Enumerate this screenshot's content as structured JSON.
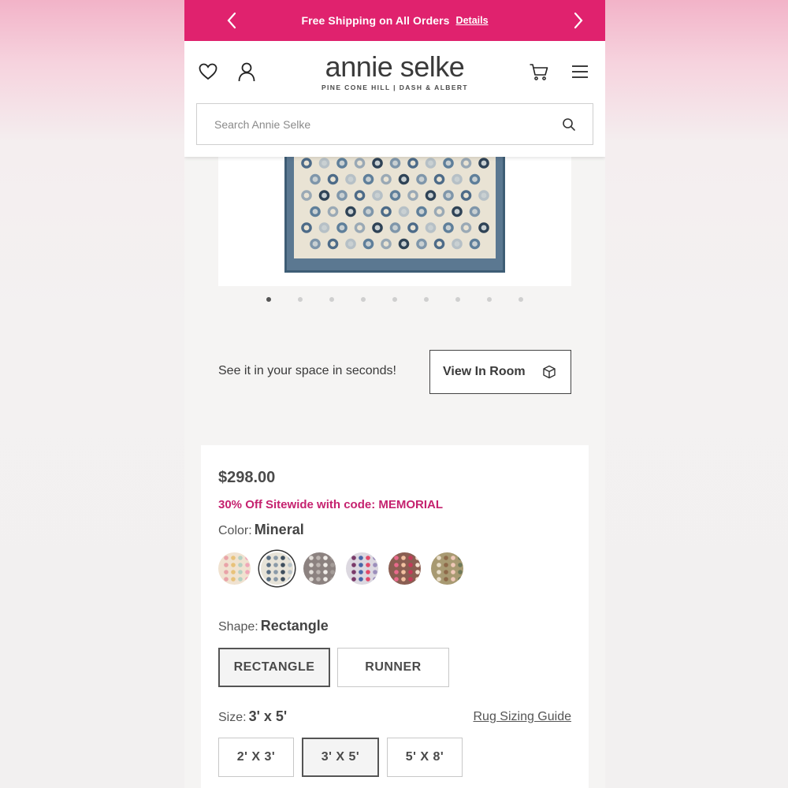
{
  "promo_bar": {
    "text": "Free Shipping on All Orders",
    "link": "Details",
    "background": "#e0226e"
  },
  "header": {
    "logo_main": "annie selke",
    "logo_sub": "PINE CONE HILL  |  DASH & ALBERT",
    "icons": [
      "heart-icon",
      "account-icon",
      "cart-icon",
      "menu-icon"
    ]
  },
  "search": {
    "placeholder": "Search Annie Selke"
  },
  "gallery": {
    "dot_count": 9,
    "active_index": 0
  },
  "view_in_room": {
    "prompt": "See it in your space in seconds!",
    "button_label": "View In Room"
  },
  "product": {
    "price": "$298.00",
    "promo": "30% Off Sitewide with code: MEMORIAL",
    "promo_color": "#c5226f",
    "color": {
      "label": "Color:",
      "value": "Mineral",
      "swatches": [
        {
          "name": "pastel",
          "bg": "#f0e2d0",
          "dots": [
            "#e9a3a8",
            "#e8c27a",
            "#b5d0c2",
            "#f0a7b8"
          ]
        },
        {
          "name": "mineral",
          "bg": "#e7e3d8",
          "dots": [
            "#5a6f84",
            "#8a9aa8",
            "#3f4f5e",
            "#b7c2c8"
          ],
          "selected": true
        },
        {
          "name": "gray",
          "bg": "#8c8280",
          "dots": [
            "#e2ddd8",
            "#bcb4b0",
            "#f0ece8",
            "#a59d99"
          ]
        },
        {
          "name": "multi",
          "bg": "#dcd8e0",
          "dots": [
            "#7a3b6a",
            "#4a66a8",
            "#e24a6a",
            "#9c8fbc"
          ]
        },
        {
          "name": "berry",
          "bg": "#8a5e52",
          "dots": [
            "#e86a8c",
            "#f2c0a0",
            "#c43a5a",
            "#f5e0d0"
          ]
        },
        {
          "name": "olive",
          "bg": "#a89a72",
          "dots": [
            "#e8ddc8",
            "#8e6a4a",
            "#f0c8b8",
            "#6f7a5a"
          ]
        }
      ]
    },
    "shape": {
      "label": "Shape:",
      "value": "Rectangle",
      "options": [
        "RECTANGLE",
        "RUNNER"
      ],
      "selected": 0
    },
    "size": {
      "label": "Size:",
      "value": "3' x 5'",
      "guide": "Rug Sizing Guide",
      "options": [
        "2' X 3'",
        "3' X 5'",
        "5' X 8'"
      ],
      "selected": 1
    }
  }
}
